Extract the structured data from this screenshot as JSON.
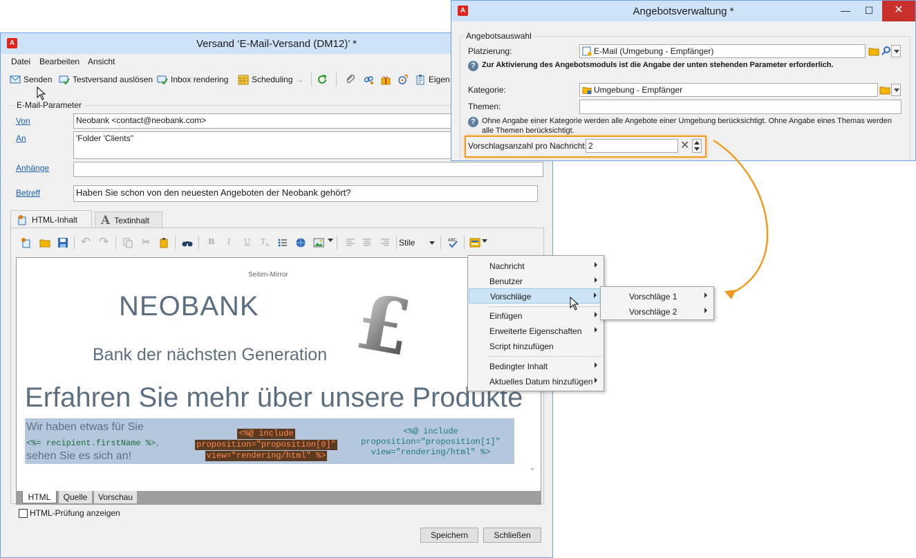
{
  "colors": {
    "accent": "#f29a1f",
    "link": "#1a5fb4",
    "titlebar": "#cfe3f8",
    "selection": "#cce4f7"
  },
  "versand": {
    "title": "Versand ‘E-Mail-Versand (DM12)’ *",
    "menu": [
      "Datei",
      "Bearbeiten",
      "Ansicht"
    ],
    "toolbar": {
      "send": "Senden",
      "test": "Testversand auslösen",
      "inbox": "Inbox rendering",
      "scheduling": "Scheduling",
      "props": "Eigen"
    },
    "email_params_legend": "E-Mail-Parameter",
    "fields": {
      "from_label": "Von",
      "from_value": "Neobank <contact@neobank.com>",
      "to_label": "An",
      "to_value": "'Folder 'Clients''",
      "attachments_label": "Anhänge",
      "attachments_value": "",
      "subject_label": "Betreff",
      "subject_value": "Haben Sie schon von den neuesten Angeboten der Neobank gehört?"
    },
    "tabs": {
      "html": "HTML-Inhalt",
      "text": "Textinhalt"
    },
    "editor": {
      "style_select": "Stile",
      "mirror": "Seiten-Mirror",
      "brand": "NEOBANK",
      "tagline": "Bank der nächsten Generation",
      "headline": "Erfahren Sie mehr über unsere Produkte",
      "intro_line1": "Wir haben etwas für Sie",
      "intro_code": "<%= recipient.firstName %>",
      "intro_comma": ",",
      "intro_line3": "sehen Sie es sich an!",
      "prop0": [
        "<%@ include",
        "proposition=\"proposition[0]\"",
        "view=\"rendering/html\" %>"
      ],
      "prop1": [
        "<%@ include",
        "proposition=\"proposition[1]\"",
        "view=\"rendering/html\" %>"
      ]
    },
    "bottom_tabs": [
      "HTML",
      "Quelle",
      "Vorschau"
    ],
    "html_check": "HTML-Prüfung anzeigen",
    "save": "Speichern",
    "close": "Schließen"
  },
  "angebot": {
    "title": "Angebotsverwaltung *",
    "legend": "Angebotsauswahl",
    "placement_label": "Platzierung:",
    "placement_value": "E-Mail (Umgebung - Empfänger)",
    "info1": "Zur Aktivierung des Angebotsmoduls ist die Angabe der unten stehenden Parameter erforderlich.",
    "category_label": "Kategorie:",
    "category_value": "Umgebung - Empfänger",
    "themes_label": "Themen:",
    "themes_value": "",
    "info2_line1": "Ohne Angabe einer Kategorie werden alle Angebote einer Umgebung berücksichtigt. Ohne Angabe eines Themas werden",
    "info2_line2": "alle Themen berücksichtigt.",
    "count_label": "Vorschlagsanzahl pro Nachricht:",
    "count_value": "2"
  },
  "context_menu": {
    "items": [
      "Nachricht",
      "Benutzer",
      "Vorschläge",
      "Einfügen",
      "Erweiterte Eigenschaften",
      "Script hinzufügen",
      "Bedingter Inhalt",
      "Aktuelles Datum hinzufügen"
    ],
    "submenu": [
      "Vorschläge 1",
      "Vorschläge 2"
    ]
  }
}
